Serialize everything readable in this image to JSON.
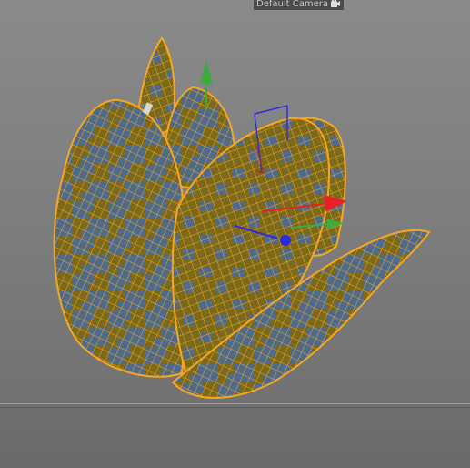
{
  "viewport": {
    "camera_label": "Default Camera",
    "camera_icon": "camera-icon",
    "background_color": "#808080",
    "floor_color": "#6c6c6c"
  },
  "object": {
    "type": "tulip-flower-mesh",
    "wire_color": "#f5a623",
    "face_color_blue": "#4e6b8c",
    "face_color_olive": "#7c6a1c",
    "selected": true
  },
  "gizmo": {
    "x_axis_color": "#e8202a",
    "y_axis_color": "#3dac3d",
    "z_axis_color": "#2a2ae0",
    "icon": "move-gizmo-icon"
  }
}
